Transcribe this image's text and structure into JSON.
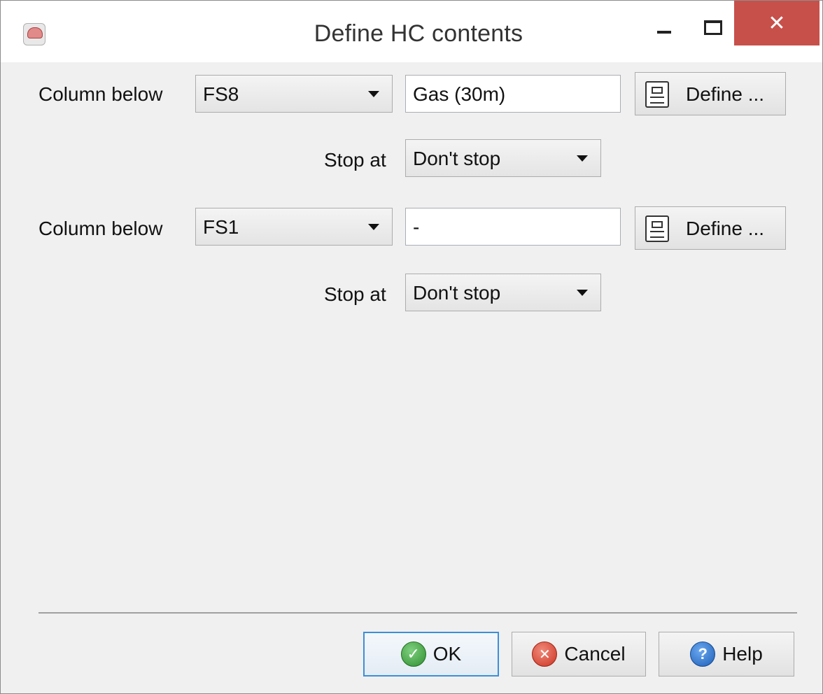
{
  "window": {
    "title": "Define HC contents",
    "close_glyph": "✕"
  },
  "rows": [
    {
      "column_label": "Column below",
      "column_value": "FS8",
      "contents_value": "Gas (30m)",
      "define_label": "Define ...",
      "stop_label": "Stop at",
      "stop_value": "Don't stop"
    },
    {
      "column_label": "Column below",
      "column_value": "FS1",
      "contents_value": "-",
      "define_label": "Define ...",
      "stop_label": "Stop at",
      "stop_value": "Don't stop"
    }
  ],
  "actions": {
    "ok_label": "OK",
    "cancel_label": "Cancel",
    "help_label": "Help",
    "ok_glyph": "✓",
    "cancel_glyph": "✕",
    "help_glyph": "?"
  },
  "colors": {
    "close_button": "#c7504a",
    "focus_border": "#3c8fd8"
  }
}
